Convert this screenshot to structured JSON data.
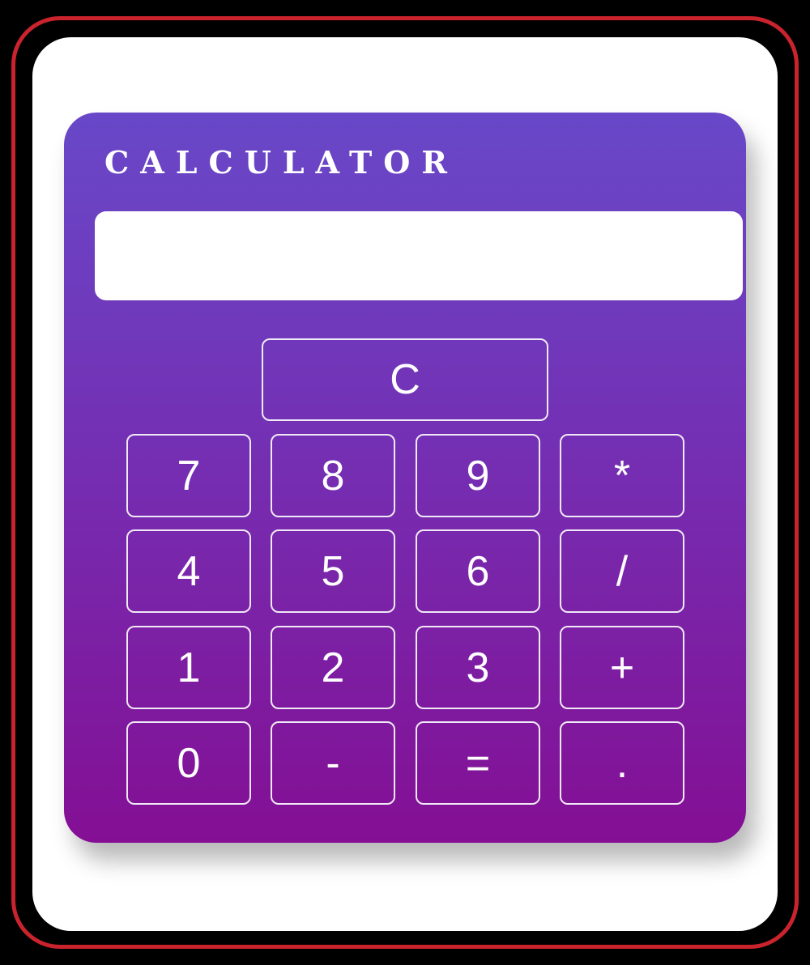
{
  "app": {
    "title": "CALCULATOR"
  },
  "display": {
    "value": ""
  },
  "clear_button": {
    "label": "C"
  },
  "keys": [
    {
      "label": "7",
      "name": "key-7"
    },
    {
      "label": "8",
      "name": "key-8"
    },
    {
      "label": "9",
      "name": "key-9"
    },
    {
      "label": "*",
      "name": "key-multiply"
    },
    {
      "label": "4",
      "name": "key-4"
    },
    {
      "label": "5",
      "name": "key-5"
    },
    {
      "label": "6",
      "name": "key-6"
    },
    {
      "label": "/",
      "name": "key-divide"
    },
    {
      "label": "1",
      "name": "key-1"
    },
    {
      "label": "2",
      "name": "key-2"
    },
    {
      "label": "3",
      "name": "key-3"
    },
    {
      "label": "+",
      "name": "key-add"
    },
    {
      "label": "0",
      "name": "key-0"
    },
    {
      "label": "-",
      "name": "key-subtract"
    },
    {
      "label": "=",
      "name": "key-equals"
    },
    {
      "label": ".",
      "name": "key-decimal"
    }
  ],
  "colors": {
    "frame_border": "#c9232d",
    "gradient_top": "#6848c8",
    "gradient_bottom": "#840f94",
    "button_border": "#f0eaf6",
    "text": "#ffffff"
  }
}
